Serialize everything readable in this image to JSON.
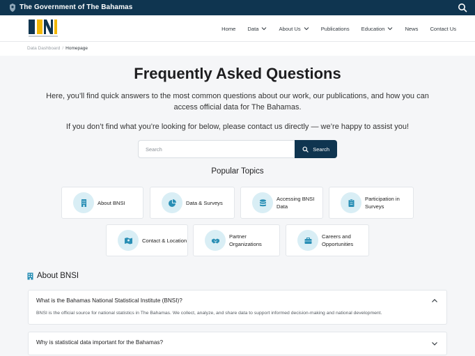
{
  "gov_bar": {
    "title": "The Government of The Bahamas",
    "crest_icon": "coat-of-arms-icon",
    "search_icon": "search-icon"
  },
  "nav": {
    "logo_text": "BNSI",
    "items": [
      {
        "label": "Home"
      },
      {
        "label": "Data",
        "dropdown": true
      },
      {
        "label": "About Us",
        "dropdown": true
      },
      {
        "label": "Publications"
      },
      {
        "label": "Education",
        "dropdown": true
      },
      {
        "label": "News"
      },
      {
        "label": "Contact Us"
      }
    ]
  },
  "breadcrumb": {
    "parent": "Data Dashboard",
    "current": "Homepage"
  },
  "hero": {
    "title": "Frequently Asked Questions",
    "description": "Here, you’ll find quick answers to the most common questions about our work, our publications, and how you can access official data for The Bahamas.",
    "note": "If you don’t find what you’re looking for below, please contact us directly — we’re happy to assist you!"
  },
  "search": {
    "placeholder": "Search",
    "button_label": "Search"
  },
  "popular_topics": {
    "title": "Popular Topics",
    "items": [
      {
        "label": "About BNSI",
        "icon": "building-icon"
      },
      {
        "label": "Data & Surveys",
        "icon": "pie-chart-icon"
      },
      {
        "label": "Accessing BNSI Data",
        "icon": "database-icon"
      },
      {
        "label": "Participation in Surveys",
        "icon": "clipboard-icon"
      },
      {
        "label": "Contact & Location",
        "icon": "map-icon"
      },
      {
        "label": "Partner Organizations",
        "icon": "handshake-icon"
      },
      {
        "label": "Careers and Opportunities",
        "icon": "briefcase-icon"
      }
    ]
  },
  "section": {
    "title": "About BNSI",
    "icon": "building-icon"
  },
  "faqs": [
    {
      "question": "What is the Bahamas National Statistical Institute (BNSI)?",
      "answer": "BNSI is the official source for national statistics in The Bahamas. We collect, analyze, and share data to support informed decision-making and national development.",
      "expanded": true
    },
    {
      "question": "Why is statistical data important for the Bahamas?",
      "expanded": false
    }
  ],
  "colors": {
    "navy": "#0f3550",
    "icon_bg": "#d9eef5",
    "icon_fg": "#2a8fb5",
    "page_bg": "#f5f6f8"
  }
}
